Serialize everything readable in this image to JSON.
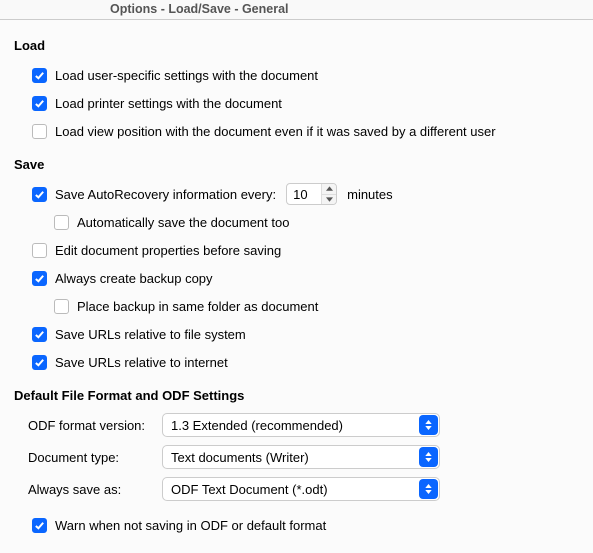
{
  "header": {
    "title": "Options - Load/Save - General"
  },
  "sections": {
    "load": {
      "title": "Load",
      "userSettings": {
        "label": "Load user-specific settings with the document",
        "checked": true
      },
      "printerSettings": {
        "label": "Load printer settings with the document",
        "checked": true
      },
      "viewPosition": {
        "label": "Load view position with the document even if it was saved by a different user",
        "checked": false
      }
    },
    "save": {
      "title": "Save",
      "autoRecovery": {
        "label": "Save AutoRecovery information every:",
        "value": "10",
        "unit": "minutes",
        "checked": true
      },
      "autoSaveDoc": {
        "label": "Automatically save the document too",
        "checked": false
      },
      "editProps": {
        "label": "Edit document properties before saving",
        "checked": false
      },
      "backupCopy": {
        "label": "Always create backup copy",
        "checked": true
      },
      "backupSameFolder": {
        "label": "Place backup in same folder as document",
        "checked": false
      },
      "urlFile": {
        "label": "Save URLs relative to file system",
        "checked": true
      },
      "urlInternet": {
        "label": "Save URLs relative to internet",
        "checked": true
      }
    },
    "format": {
      "title": "Default File Format and ODF Settings",
      "odfVersion": {
        "label": "ODF format version:",
        "value": "1.3 Extended (recommended)"
      },
      "docType": {
        "label": "Document type:",
        "value": "Text documents (Writer)"
      },
      "alwaysSave": {
        "label": "Always save as:",
        "value": "ODF Text Document (*.odt)"
      },
      "warn": {
        "label": "Warn when not saving in ODF or default format",
        "checked": true
      }
    }
  }
}
